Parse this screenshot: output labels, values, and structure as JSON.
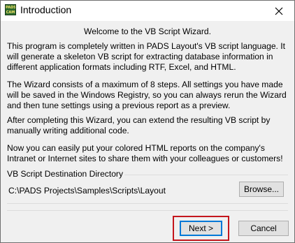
{
  "window": {
    "title": "Introduction",
    "app_icon_text": "PADS\nCAM",
    "close_icon": "close-icon"
  },
  "content": {
    "heading": "Welcome to the VB Script Wizard.",
    "paragraphs": [
      "This program is completely written in PADS Layout's VB script language. It will generate a skeleton VB script for extracting database information in different application formats including RTF, Excel, and HTML.",
      "The Wizard consists of a maximum of 8 steps. All settings you have made will be saved in the Windows Registry, so you can always rerun the Wizard and then tune settings using a previous report as a preview.",
      "After completing this Wizard, you can extend the resulting VB script by manually writing additional code.",
      "Now you can easily put your colored HTML reports on the company's Intranet or Internet sites to share them with your colleagues or customers!"
    ]
  },
  "destination": {
    "group_label": "VB Script Destination Directory",
    "path": "C:\\PADS Projects\\Samples\\Scripts\\Layout",
    "browse_label": "Browse..."
  },
  "footer": {
    "next_label": "Next >",
    "cancel_label": "Cancel"
  },
  "colors": {
    "highlight": "#c4161c",
    "focus": "#0078d7",
    "dialog_bg": "#f0f0f0"
  }
}
